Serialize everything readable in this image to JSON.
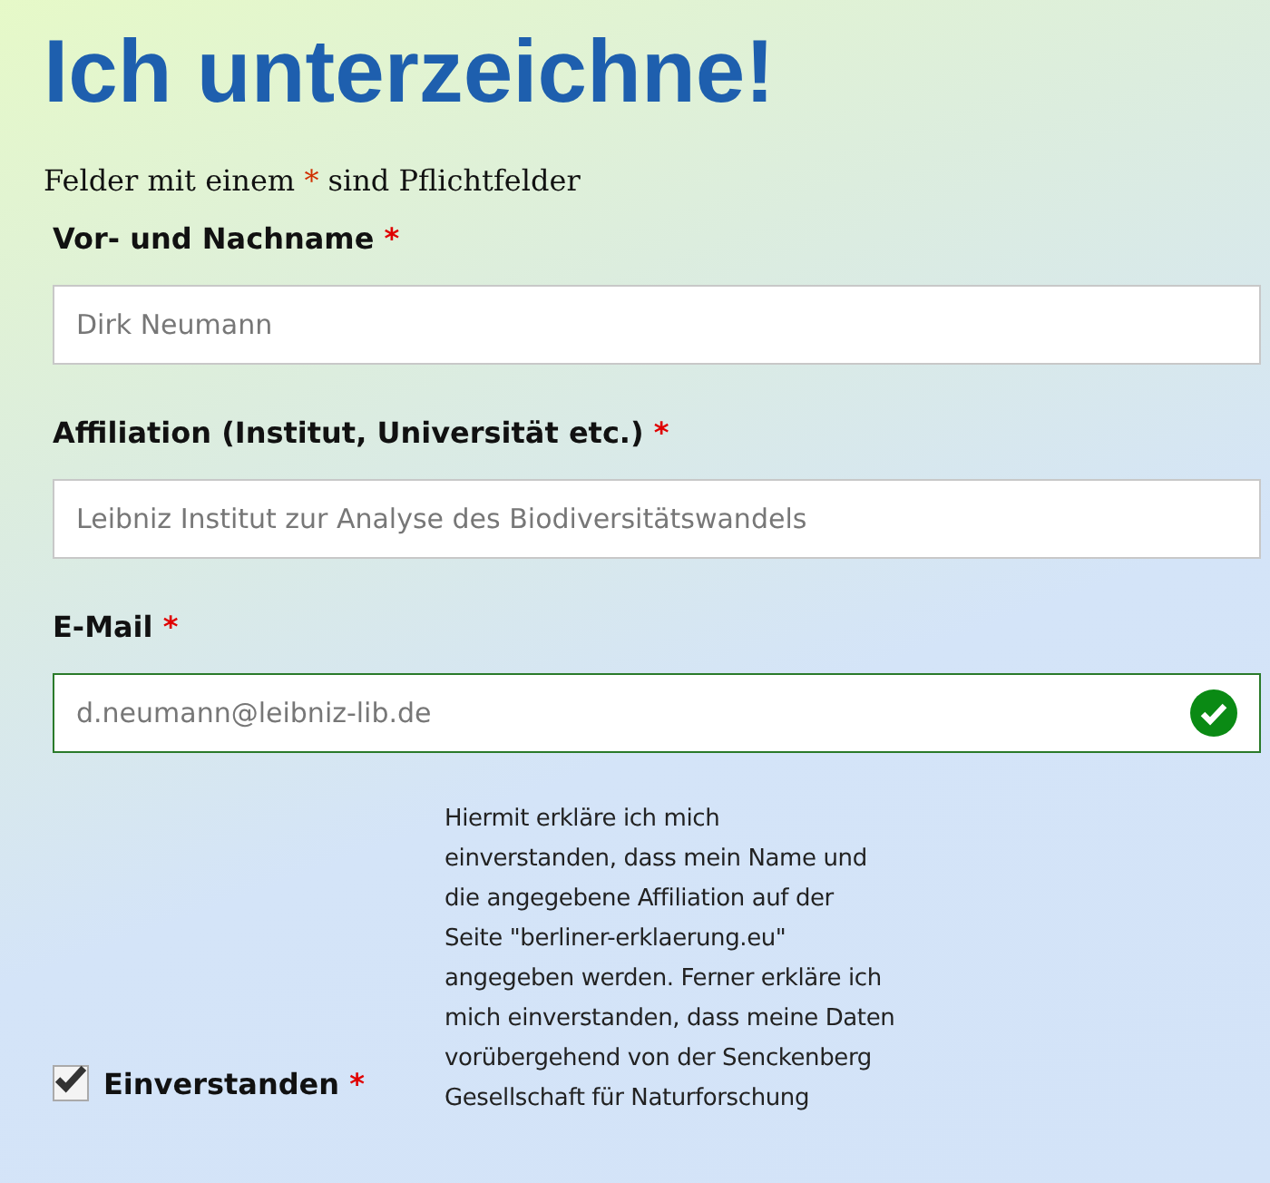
{
  "title": "Ich unterzeichne!",
  "intro": {
    "before": "Felder mit einem",
    "marker": "*",
    "after": "sind Pflichtfelder"
  },
  "fields": [
    {
      "label": "Vor- und Nachname",
      "required": true,
      "value": "Dirk Neumann",
      "valid": false
    },
    {
      "label": "Affiliation (Institut, Universität etc.)",
      "required": true,
      "value": "Leibniz Institut zur Analyse des Biodiversitätswandels",
      "valid": false
    },
    {
      "label": "E-Mail",
      "required": true,
      "value": "d.neumann@leibniz-lib.de",
      "valid": true
    }
  ],
  "consent": {
    "label": "Einverstanden",
    "required": true,
    "checked": true,
    "text": "Hiermit erkläre ich mich einverstanden, dass mein Name und die angegebene Affiliation auf der Seite \"berliner-erklaerung.eu\" angegeben werden. Ferner erkläre ich mich einverstanden, dass meine Daten vorübergehend von der Senckenberg Gesellschaft für Naturforschung"
  }
}
